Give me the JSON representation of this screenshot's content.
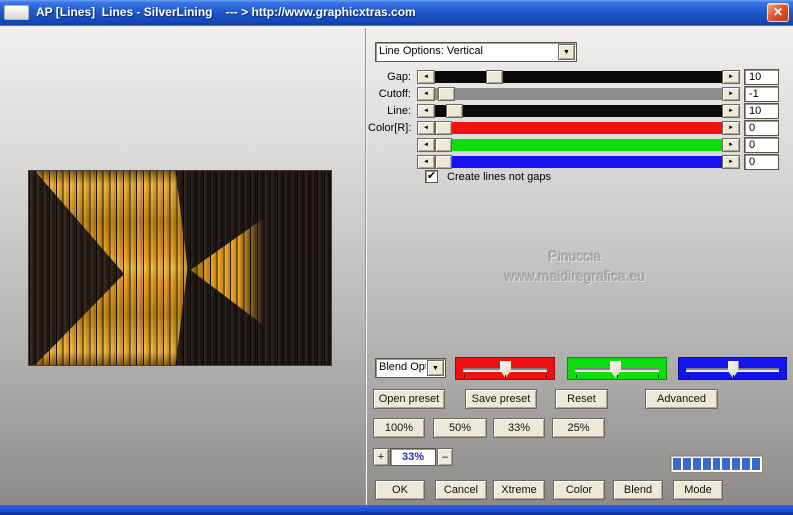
{
  "window": {
    "title": "AP [Lines]  Lines - SilverLining    --- > http://www.graphicxtras.com"
  },
  "icons": {
    "close": "✕",
    "dropdown_arrow": "▼",
    "left_arrow": "◄",
    "right_arrow": "►",
    "check": "✔"
  },
  "panel": {
    "line_options_value": "Line Options: Vertical",
    "sliders": [
      {
        "label": "Gap:",
        "value": "10",
        "track_color": "#0a0a0a",
        "thumb_pct": 19
      },
      {
        "label": "Cutoff:",
        "value": "-1",
        "track_color": "#8f8f8f",
        "thumb_pct": 1
      },
      {
        "label": "Line:",
        "value": "10",
        "track_color": "#0a0a0a",
        "thumb_pct": 4
      },
      {
        "label": "Color[R]:",
        "value": "0",
        "track_color": "#ee1111",
        "thumb_pct": 0
      },
      {
        "label": "",
        "value": "0",
        "track_color": "#0ddd0d",
        "thumb_pct": 0
      },
      {
        "label": "",
        "value": "0",
        "track_color": "#1414ee",
        "thumb_pct": 0
      }
    ],
    "checkbox_label": "Create lines not gaps",
    "checkbox_checked": true,
    "blend_select_value": "Blend Optio",
    "rgb_trackbars": [
      {
        "name": "red",
        "color": "#ee1111",
        "thumb_pct": 50
      },
      {
        "name": "green",
        "color": "#0ddd0d",
        "thumb_pct": 48
      },
      {
        "name": "blue",
        "color": "#1414ee",
        "thumb_pct": 50
      }
    ],
    "preset_buttons": [
      "Open preset",
      "Save preset",
      "Reset",
      "Advanced"
    ],
    "percent_buttons": [
      "100%",
      "50%",
      "33%",
      "25%"
    ],
    "stepper": {
      "plus": "+",
      "value": "33%",
      "minus": "–"
    },
    "action_buttons": [
      "OK",
      "Cancel",
      "Xtreme",
      "Color",
      "Blend",
      "Mode"
    ],
    "progress": {
      "segments": 9,
      "color": "#3a68c8"
    }
  },
  "watermark": {
    "line1": "Pinuccia",
    "line2": "www.maidiregrafica.eu"
  },
  "preview": {
    "bg": "#261b14",
    "gold": "#eda41f"
  }
}
